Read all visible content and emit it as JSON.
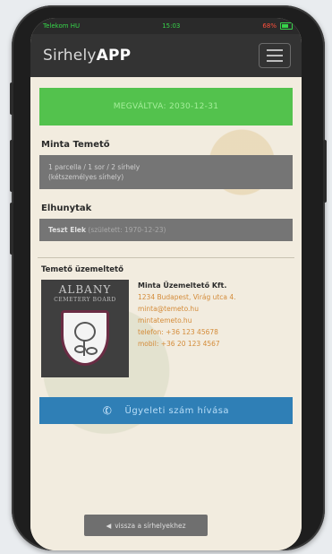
{
  "status": {
    "carrier": "Telekom HU",
    "time": "15:03",
    "battery": "68%"
  },
  "nav": {
    "brand_prefix": "Sirhely",
    "brand_suffix": "APP",
    "menu_icon": "hamburger-icon"
  },
  "banner": {
    "text": "MEGVÁLTVA: 2030-12-31"
  },
  "cemetery": {
    "name": "Minta Temető",
    "line1": "1 parcella / 1 sor / 2 sírhely",
    "line2": "(kétszemélyes sírhely)"
  },
  "deceased": {
    "title": "Elhunytak",
    "name": "Teszt Elek",
    "date": "(született: 1970-12-23)"
  },
  "operator": {
    "title": "Temető üzemeltető",
    "logo_line1": "ALBANY",
    "logo_line2": "CEMETERY BOARD",
    "company": "Minta Üzemeltető Kft.",
    "address": "1234 Budapest, Virág utca 4.",
    "email": "minta@temeto.hu",
    "website": "mintatemeto.hu",
    "phone": "telefon: +36 123 45678",
    "mobile": "mobil: +36 20 123 4567"
  },
  "actions": {
    "call_label": "Ügyeleti szám hívása",
    "back_label": "vissza a sírhelyekhez"
  },
  "colors": {
    "banner": "#53c24d",
    "call_button": "#2f7fb6",
    "navbar": "#333333"
  }
}
